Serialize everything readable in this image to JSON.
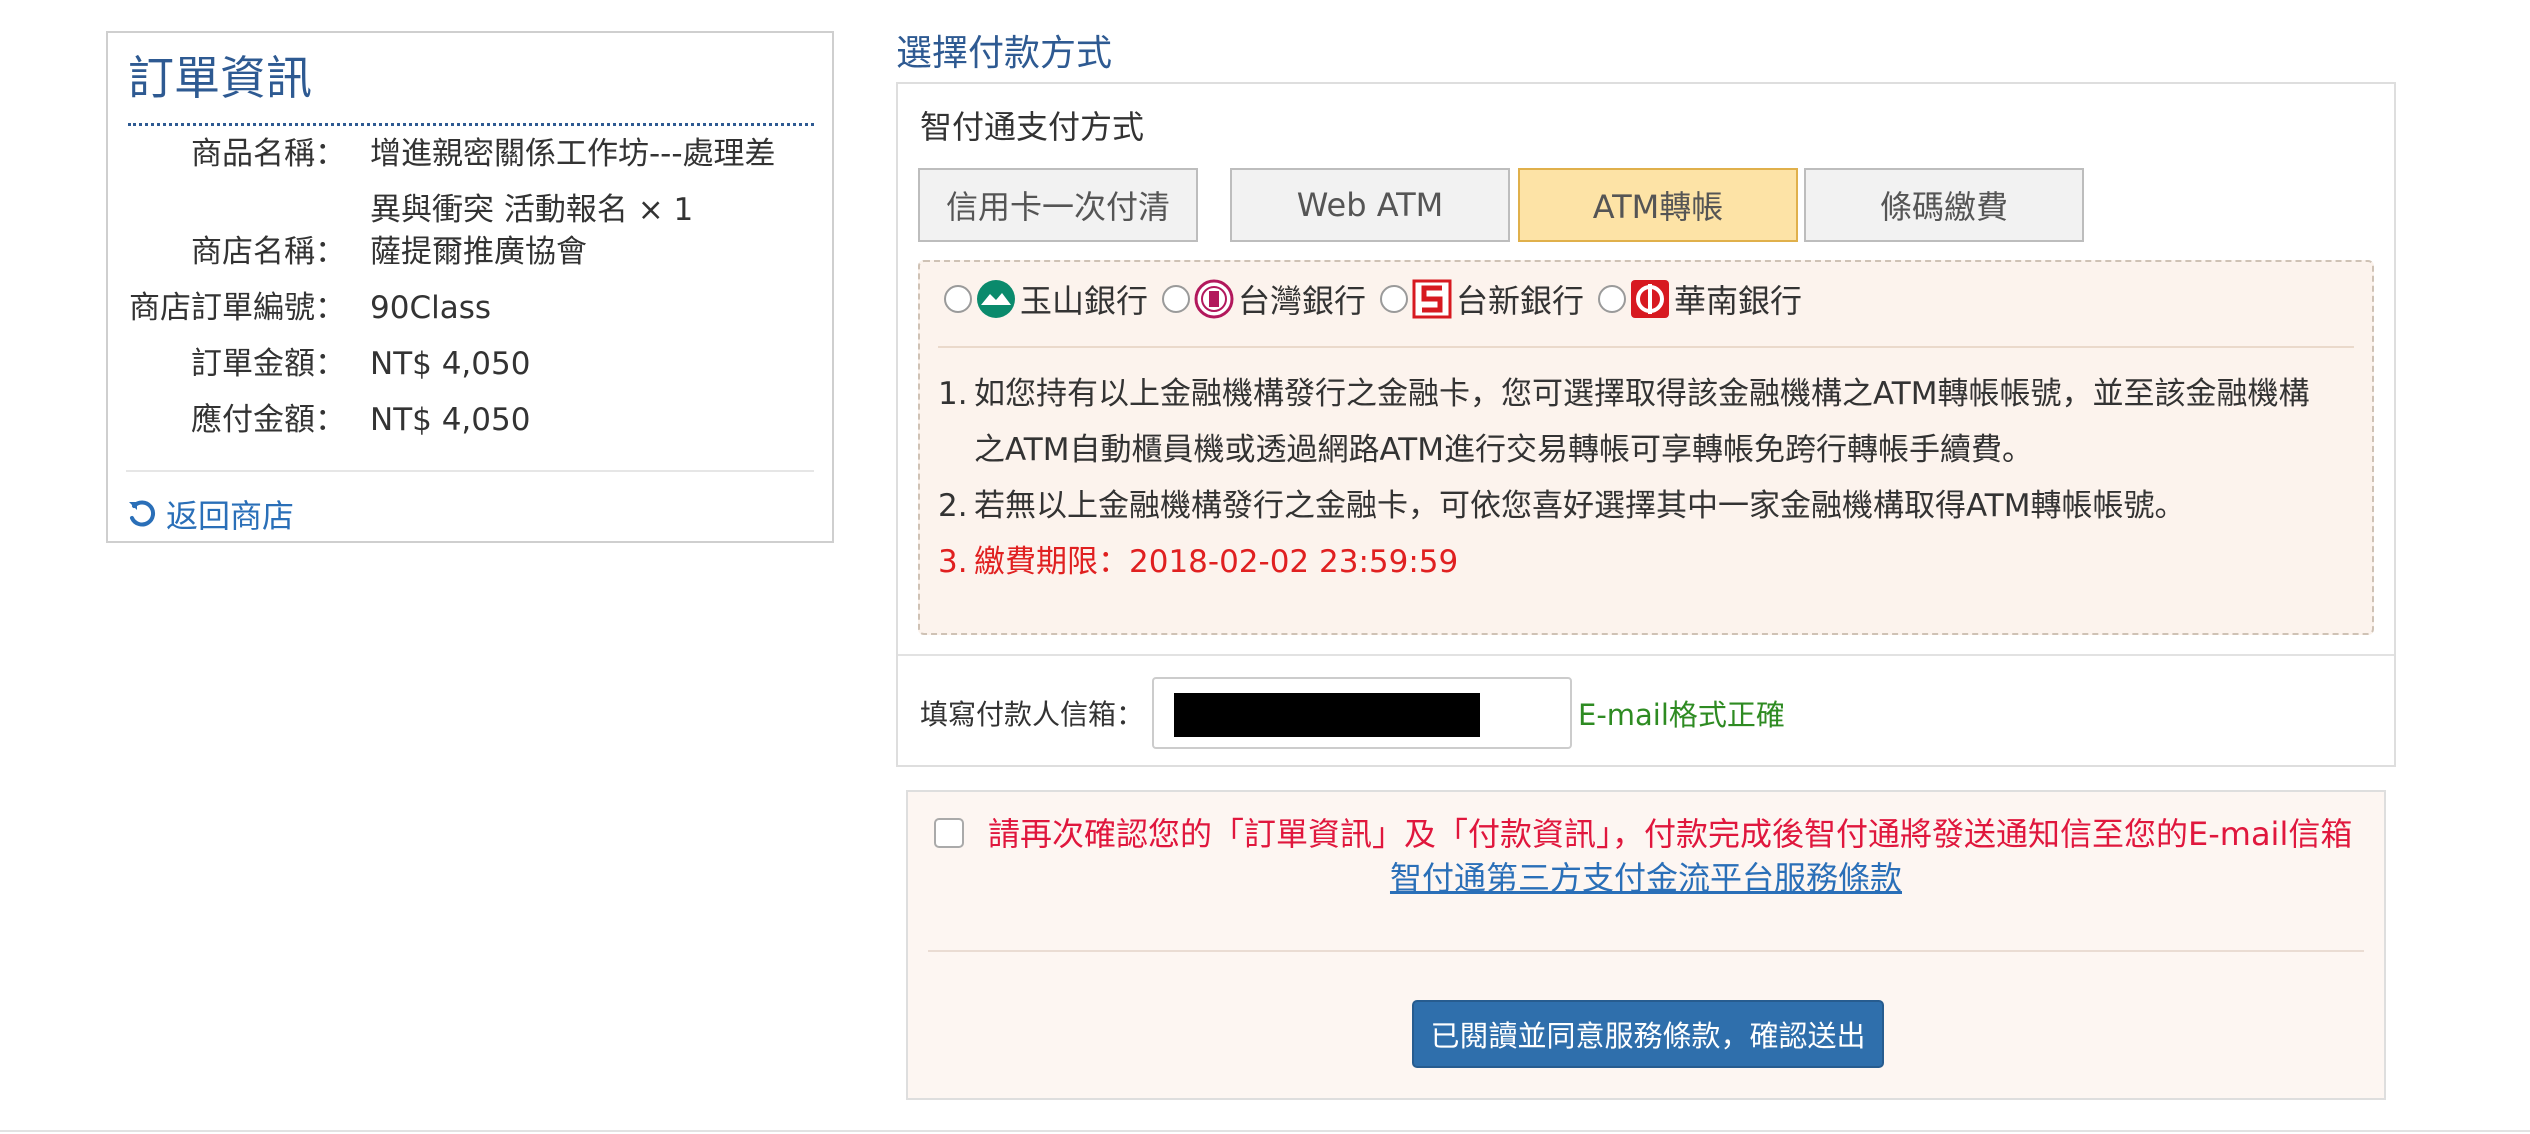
{
  "order": {
    "title": "訂單資訊",
    "rows": [
      {
        "label": "商品名稱：",
        "value_line1": "增進親密關係工作坊---處理差",
        "value_line2": "異與衝突 活動報名 × 1"
      },
      {
        "label": "商店名稱：",
        "value": "薩提爾推廣協會"
      },
      {
        "label": "商店訂單編號：",
        "value": "90Class"
      },
      {
        "label": "訂單金額：",
        "value": "NT$ 4,050"
      },
      {
        "label": "應付金額：",
        "value": "NT$ 4,050"
      }
    ],
    "back_link": "返回商店"
  },
  "payment": {
    "title": "選擇付款方式",
    "subtitle": "智付通支付方式",
    "tabs": [
      {
        "label": "信用卡一次付清",
        "active": false
      },
      {
        "label": "Web ATM",
        "active": false
      },
      {
        "label": "ATM轉帳",
        "active": true
      },
      {
        "label": "條碼繳費",
        "active": false
      }
    ],
    "banks": [
      {
        "name": "玉山銀行",
        "icon": "esun-bank-icon",
        "color": "#0a8a6c"
      },
      {
        "name": "台灣銀行",
        "icon": "bank-of-taiwan-icon",
        "color": "#b2185c"
      },
      {
        "name": "台新銀行",
        "icon": "taishin-bank-icon",
        "color": "#d71920"
      },
      {
        "name": "華南銀行",
        "icon": "hua-nan-bank-icon",
        "color": "#d71920"
      }
    ],
    "notes": [
      {
        "num": "1.",
        "line1": "如您持有以上金融機構發行之金融卡，您可選擇取得該金融機構之ATM轉帳帳號，並至該金融機構",
        "line2": "之ATM自動櫃員機或透過網路ATM進行交易轉帳可享轉帳免跨行轉帳手續費。"
      },
      {
        "num": "2.",
        "line1": "若無以上金融機構發行之金融卡，可依您喜好選擇其中一家金融機構取得ATM轉帳帳號。"
      },
      {
        "num": "3.",
        "line1": "繳費期限：2018-02-02 23:59:59"
      }
    ],
    "email_label": "填寫付款人信箱：",
    "email_status": "E-mail格式正確"
  },
  "confirm": {
    "text": "請再次確認您的「訂單資訊」及「付款資訊」，付款完成後智付通將發送通知信至您的E-mail信箱",
    "terms_link": "智付通第三方支付金流平台服務條款",
    "submit_label": "已閱讀並同意服務條款，確認送出"
  },
  "colors": {
    "accent_blue": "#2e5a92",
    "link_blue": "#2a6fb8",
    "warning_red": "#e0173d",
    "success_green": "#2e8b22",
    "active_tab": "#fde3a6"
  }
}
